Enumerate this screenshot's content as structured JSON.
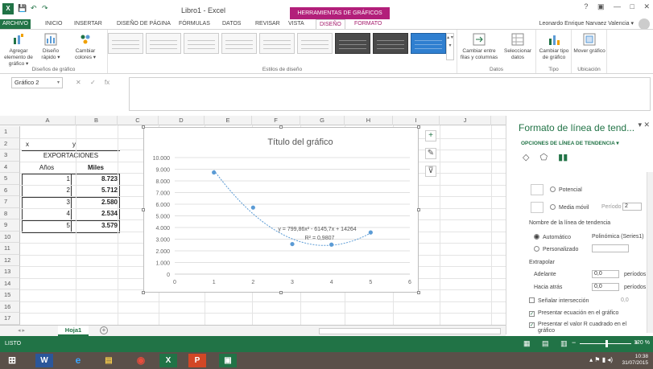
{
  "titlebar": {
    "title": "Libro1 - Excel",
    "context_tools": "HERRAMIENTAS DE GRÁFICOS",
    "qa_save": "💾",
    "qa_undo": "↶",
    "qa_redo": "↷",
    "excel_badge": "X",
    "ctrl_help": "?",
    "ctrl_ribbon": "▣",
    "ctrl_min": "—",
    "ctrl_max": "□",
    "ctrl_close": "✕"
  },
  "tabs": {
    "file": "ARCHIVO",
    "inicio": "INICIO",
    "insertar": "INSERTAR",
    "diseno_pagina": "DISEÑO DE PÁGINA",
    "formulas": "FÓRMULAS",
    "datos": "DATOS",
    "revisar": "REVISAR",
    "vista": "VISTA",
    "diseno": "DISEÑO",
    "formato": "FORMATO",
    "user": "Leonardo Enrique Narvaez Valencia ▾"
  },
  "ribbon": {
    "add_element": "Agregar elemento de gráfico ▾",
    "quick_layout": "Diseño rápido ▾",
    "change_colors": "Cambiar colores ▾",
    "group_layouts": "Diseños de gráfico",
    "group_styles": "Estilos de diseño",
    "switch_rows": "Cambiar entre filas y columnas",
    "select_data": "Seleccionar datos",
    "group_data": "Datos",
    "change_type": "Cambiar tipo de gráfico",
    "group_type": "Tipo",
    "move_chart": "Mover gráfico",
    "group_location": "Ubicación",
    "scroll_glyph": "▴ ▾ ▾"
  },
  "formula_bar": {
    "name_box": "Gráfico 2",
    "name_box_arrow": "▾",
    "cancel": "✕",
    "enter": "✓",
    "fx": "fx"
  },
  "grid": {
    "columns": [
      "A",
      "B",
      "C",
      "D",
      "E",
      "F",
      "G",
      "H",
      "I",
      "J"
    ],
    "rows": [
      "1",
      "2",
      "3",
      "4",
      "5",
      "6",
      "7",
      "8",
      "9",
      "10",
      "11",
      "12",
      "13",
      "14",
      "15",
      "16",
      "17"
    ],
    "cell_x": "x",
    "cell_y": "y",
    "title": "EXPORTACIONES",
    "header_years": "Años",
    "header_thousands": "Miles",
    "years": [
      "1",
      "2",
      "3",
      "4",
      "5"
    ],
    "thousands": [
      "8.723",
      "5.712",
      "2.580",
      "2.534",
      "3.579"
    ]
  },
  "chart_data": {
    "type": "scatter",
    "title": "Título del gráfico",
    "x": [
      1,
      2,
      3,
      4,
      5
    ],
    "y": [
      8723,
      5712,
      2580,
      2534,
      3579
    ],
    "xlim": [
      0,
      6
    ],
    "ylim": [
      0,
      10000
    ],
    "x_ticks": [
      "0",
      "1",
      "2",
      "3",
      "4",
      "5",
      "6"
    ],
    "y_ticks": [
      "0",
      "1.000",
      "2.000",
      "3.000",
      "4.000",
      "5.000",
      "6.000",
      "7.000",
      "8.000",
      "9.000",
      "10.000"
    ],
    "trendline": {
      "type": "polynomial",
      "coefficients": [
        799.86,
        -6145.7,
        14264
      ]
    },
    "equation": "y = 799,86x² - 6145,7x + 14264",
    "r_squared": "R² = 0,9807",
    "grid": "horizontal",
    "point_color": "#5b9bd5"
  },
  "chart_buttons": {
    "add": "+",
    "style": "✎",
    "filter": "⊽"
  },
  "pane": {
    "title": "Formato de línea de tend...",
    "close": "✕",
    "pin": "▾",
    "subtitle": "OPCIONES DE LÍNEA DE TENDENCIA ▾",
    "icon_fill": "◇",
    "icon_effects": "⬠",
    "icon_bars": "▮▮",
    "opt_power": "Potencial",
    "opt_moving": "Media móvil",
    "period_label": "Período",
    "period_value": "2",
    "name_section": "Nombre de la línea de tendencia",
    "name_auto": "Automático",
    "name_auto_value": "Polinómica (Series1)",
    "name_custom": "Personalizado",
    "extrapolate": "Extrapolar",
    "forward": "Adelante",
    "forward_value": "0,0",
    "forward_unit": "períodos",
    "backward": "Hacia atrás",
    "backward_value": "0,0",
    "backward_unit": "períodos",
    "intercept": "Señalar intersección",
    "intercept_value": "0,0",
    "show_equation": "Presentar ecuación en el gráfico",
    "show_r2_line1": "Presentar el valor R cuadrado en el",
    "show_r2_line2": "gráfico"
  },
  "sheets": {
    "nav": "◂  ▸",
    "active": "Hoja1",
    "add": "+"
  },
  "status": {
    "ready": "LISTO",
    "view_normal": "▦",
    "view_layout": "▤",
    "view_break": "▥",
    "zoom_minus": "−",
    "zoom_plus": "+",
    "zoom": "120 %"
  },
  "taskbar": {
    "time": "10:38",
    "date": "31/07/2015",
    "tray": "▴ ⚑ ▮ ◂)"
  }
}
